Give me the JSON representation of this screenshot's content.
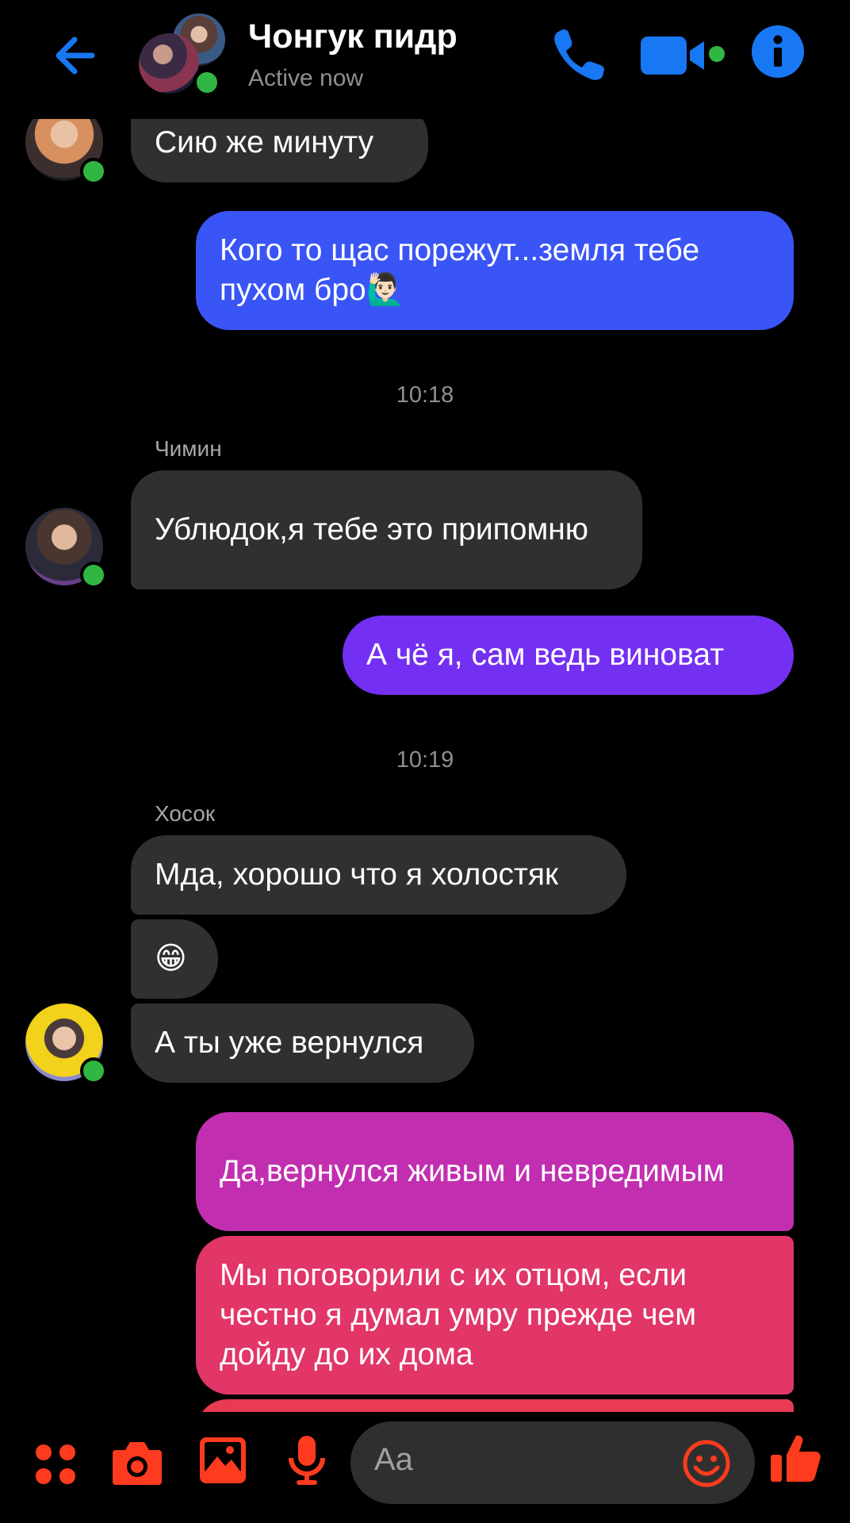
{
  "header": {
    "title": "Чонгук пидр",
    "status": "Active now"
  },
  "colors": {
    "accent": "#1877f2",
    "online": "#31b643",
    "incoming_bubble": "#303030",
    "bottom_icons": "#ff3b1f"
  },
  "messages": [
    {
      "side": "in",
      "text": "Сию же минуту"
    },
    {
      "side": "out",
      "text": "Кого то щас порежут...земля тебе пухом бро🙋🏻‍♂️"
    },
    {
      "side": "time",
      "text": "10:18"
    },
    {
      "side": "sender",
      "text": "Чимин"
    },
    {
      "side": "in",
      "text": "Ублюдок,я тебе это припомню"
    },
    {
      "side": "out",
      "text": "А чё я, сам ведь виноват"
    },
    {
      "side": "time",
      "text": "10:19"
    },
    {
      "side": "sender",
      "text": "Хосок"
    },
    {
      "side": "in",
      "text": "Мда, хорошо что я холостяк"
    },
    {
      "side": "in",
      "text": "😁"
    },
    {
      "side": "in",
      "text": "А ты уже вернулся"
    },
    {
      "side": "out",
      "text": "Да,вернулся живым и невредимым"
    },
    {
      "side": "out",
      "text": "Мы поговорили с их отцом, если честно я думал умру прежде чем дойду до их дома"
    }
  ],
  "composer": {
    "placeholder": "Aa"
  },
  "icons": {
    "back": "back-arrow-icon",
    "call": "phone-icon",
    "video": "video-camera-icon",
    "info": "info-icon",
    "more": "grid-dots-icon",
    "camera": "camera-icon",
    "gallery": "image-icon",
    "voice": "microphone-icon",
    "emoji": "smiley-icon",
    "like": "thumbs-up-icon"
  }
}
